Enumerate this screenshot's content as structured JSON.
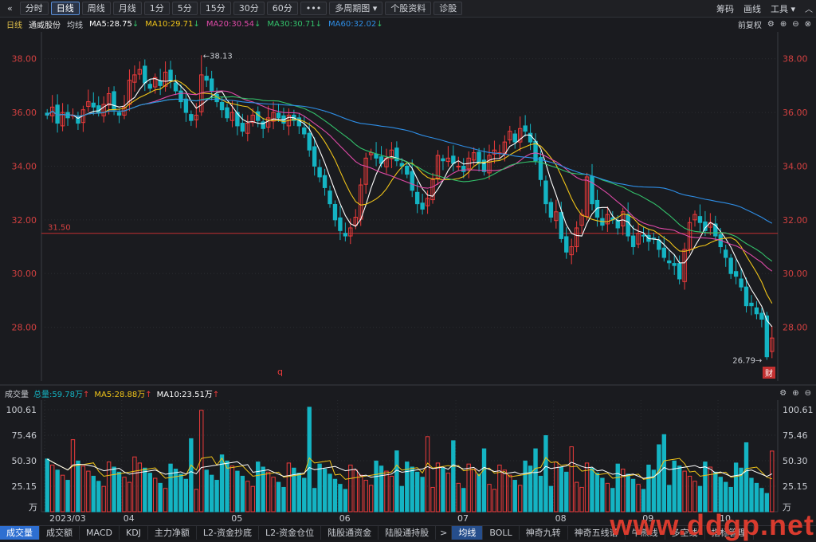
{
  "toolbar": {
    "back": "«",
    "buttons": [
      "分时",
      "日线",
      "周线",
      "月线",
      "1分",
      "5分",
      "15分",
      "30分",
      "60分",
      "•••",
      "多周期图 ▾",
      "个股资料",
      "诊股"
    ],
    "active": 1,
    "right": [
      "筹码",
      "画线",
      "工具 ▾"
    ]
  },
  "legend": {
    "period": "日线",
    "name": "通威股份",
    "label": "均线",
    "ma5": "MA5:28.75",
    "ma10": "MA10:29.71",
    "ma20": "MA20:30.54",
    "ma30": "MA30:30.71",
    "ma60": "MA60:32.02",
    "down_arrow": "↓",
    "right_label": "前复权"
  },
  "colors": {
    "up": "#ee3b3b",
    "down": "#14b4c3",
    "ma5": "#ffffff",
    "ma10": "#f0c419",
    "ma20": "#e04aa8",
    "ma30": "#33c26b",
    "ma60": "#2e8ee6",
    "axis": "#d24040",
    "refline": "#c23030"
  },
  "annotations": {
    "high": "←38.13",
    "low": "26.79→",
    "ref": "31.50",
    "marker_q": "q",
    "marker_cai": "财"
  },
  "vol_legend": {
    "label": "成交量",
    "total": "总量:59.78万",
    "ma5": "MA5:28.88万",
    "ma10": "MA10:23.51万",
    "up_arrow": "↑"
  },
  "tabs_left": [
    "成交量",
    "成交额",
    "MACD",
    "KDJ",
    "主力净额",
    "L2-资金抄底",
    "L2-资金仓位",
    "陆股通资金",
    "陆股通持股"
  ],
  "tabs_right": [
    "均线",
    "BOLL",
    "神奇九转",
    "神奇五线谱",
    "牛熊线",
    "多空线",
    "指标管理"
  ],
  "watermark": "www.ddgp.net",
  "chart_data": [
    {
      "type": "candlestick",
      "title": "通威股份 日线",
      "ylim": [
        26.0,
        39.0
      ],
      "y_ticks": [
        28.0,
        30.0,
        32.0,
        34.0,
        36.0,
        38.0
      ],
      "x_month_labels": [
        "2023/03",
        "04",
        "05",
        "06",
        "07",
        "08",
        "09",
        "10"
      ],
      "reference_line": 31.5,
      "max_price": 38.13,
      "min_price": 26.79,
      "series": [
        {
          "name": "MA5",
          "last": 28.75
        },
        {
          "name": "MA10",
          "last": 29.71
        },
        {
          "name": "MA20",
          "last": 30.54
        },
        {
          "name": "MA30",
          "last": 30.71
        },
        {
          "name": "MA60",
          "last": 32.02
        }
      ],
      "close_path": [
        35.9,
        36.2,
        35.6,
        36.0,
        35.8,
        35.9,
        35.6,
        36.1,
        36.4,
        36.2,
        36.0,
        36.3,
        36.7,
        36.1,
        35.9,
        36.2,
        37.2,
        37.4,
        37.6,
        37.1,
        36.9,
        37.3,
        37.0,
        37.5,
        37.2,
        36.8,
        36.4,
        36.0,
        35.7,
        35.9,
        37.4,
        37.2,
        36.8,
        36.4,
        36.1,
        35.8,
        36.0,
        35.5,
        35.3,
        35.6,
        35.9,
        35.7,
        35.4,
        35.8,
        36.0,
        35.8,
        35.6,
        35.9,
        35.7,
        35.5,
        35.2,
        34.6,
        34.0,
        33.6,
        33.2,
        32.6,
        32.0,
        31.6,
        31.4,
        31.7,
        32.1,
        33.3,
        34.3,
        34.5,
        34.3,
        34.1,
        34.3,
        34.6,
        34.2,
        34.0,
        33.7,
        33.1,
        32.6,
        32.4,
        32.8,
        33.5,
        34.4,
        34.2,
        34.3,
        34.1,
        34.0,
        33.8,
        34.3,
        34.5,
        34.1,
        33.8,
        34.4,
        34.6,
        34.5,
        34.9,
        35.3,
        34.9,
        35.4,
        35.3,
        34.9,
        34.2,
        33.5,
        32.6,
        32.1,
        32.3,
        31.3,
        30.8,
        31.0,
        31.7,
        32.2,
        33.6,
        32.6,
        32.1,
        31.8,
        32.2,
        32.0,
        31.7,
        32.3,
        31.4,
        31.0,
        31.5,
        31.4,
        31.2,
        31.3,
        30.9,
        30.6,
        30.4,
        30.3,
        29.8,
        30.9,
        31.9,
        32.2,
        31.9,
        31.6,
        31.9,
        31.4,
        31.0,
        30.6,
        30.0,
        29.9,
        29.5,
        28.8,
        28.8,
        28.5,
        28.3,
        26.9,
        27.6
      ],
      "volume": {
        "ylim": [
          0,
          110
        ],
        "y_ticks": [
          25.15,
          50.3,
          75.46,
          100.61
        ],
        "unit": "万",
        "last": 59.78,
        "ma5_last": 28.88,
        "ma10_last": 23.51
      }
    }
  ]
}
